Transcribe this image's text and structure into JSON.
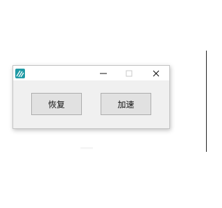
{
  "window": {
    "app_icon": "app-icon",
    "controls": {
      "minimize_icon": "minimize-icon",
      "maximize_icon": "maximize-icon",
      "close_icon": "close-icon"
    },
    "buttons": {
      "restore_label": "恢复",
      "speed_label": "加速"
    }
  },
  "colors": {
    "app_icon_bg": "#1f9aa5",
    "window_bg": "#f0f0f0",
    "button_bg": "#e1e1e1",
    "button_border": "#adadad"
  }
}
